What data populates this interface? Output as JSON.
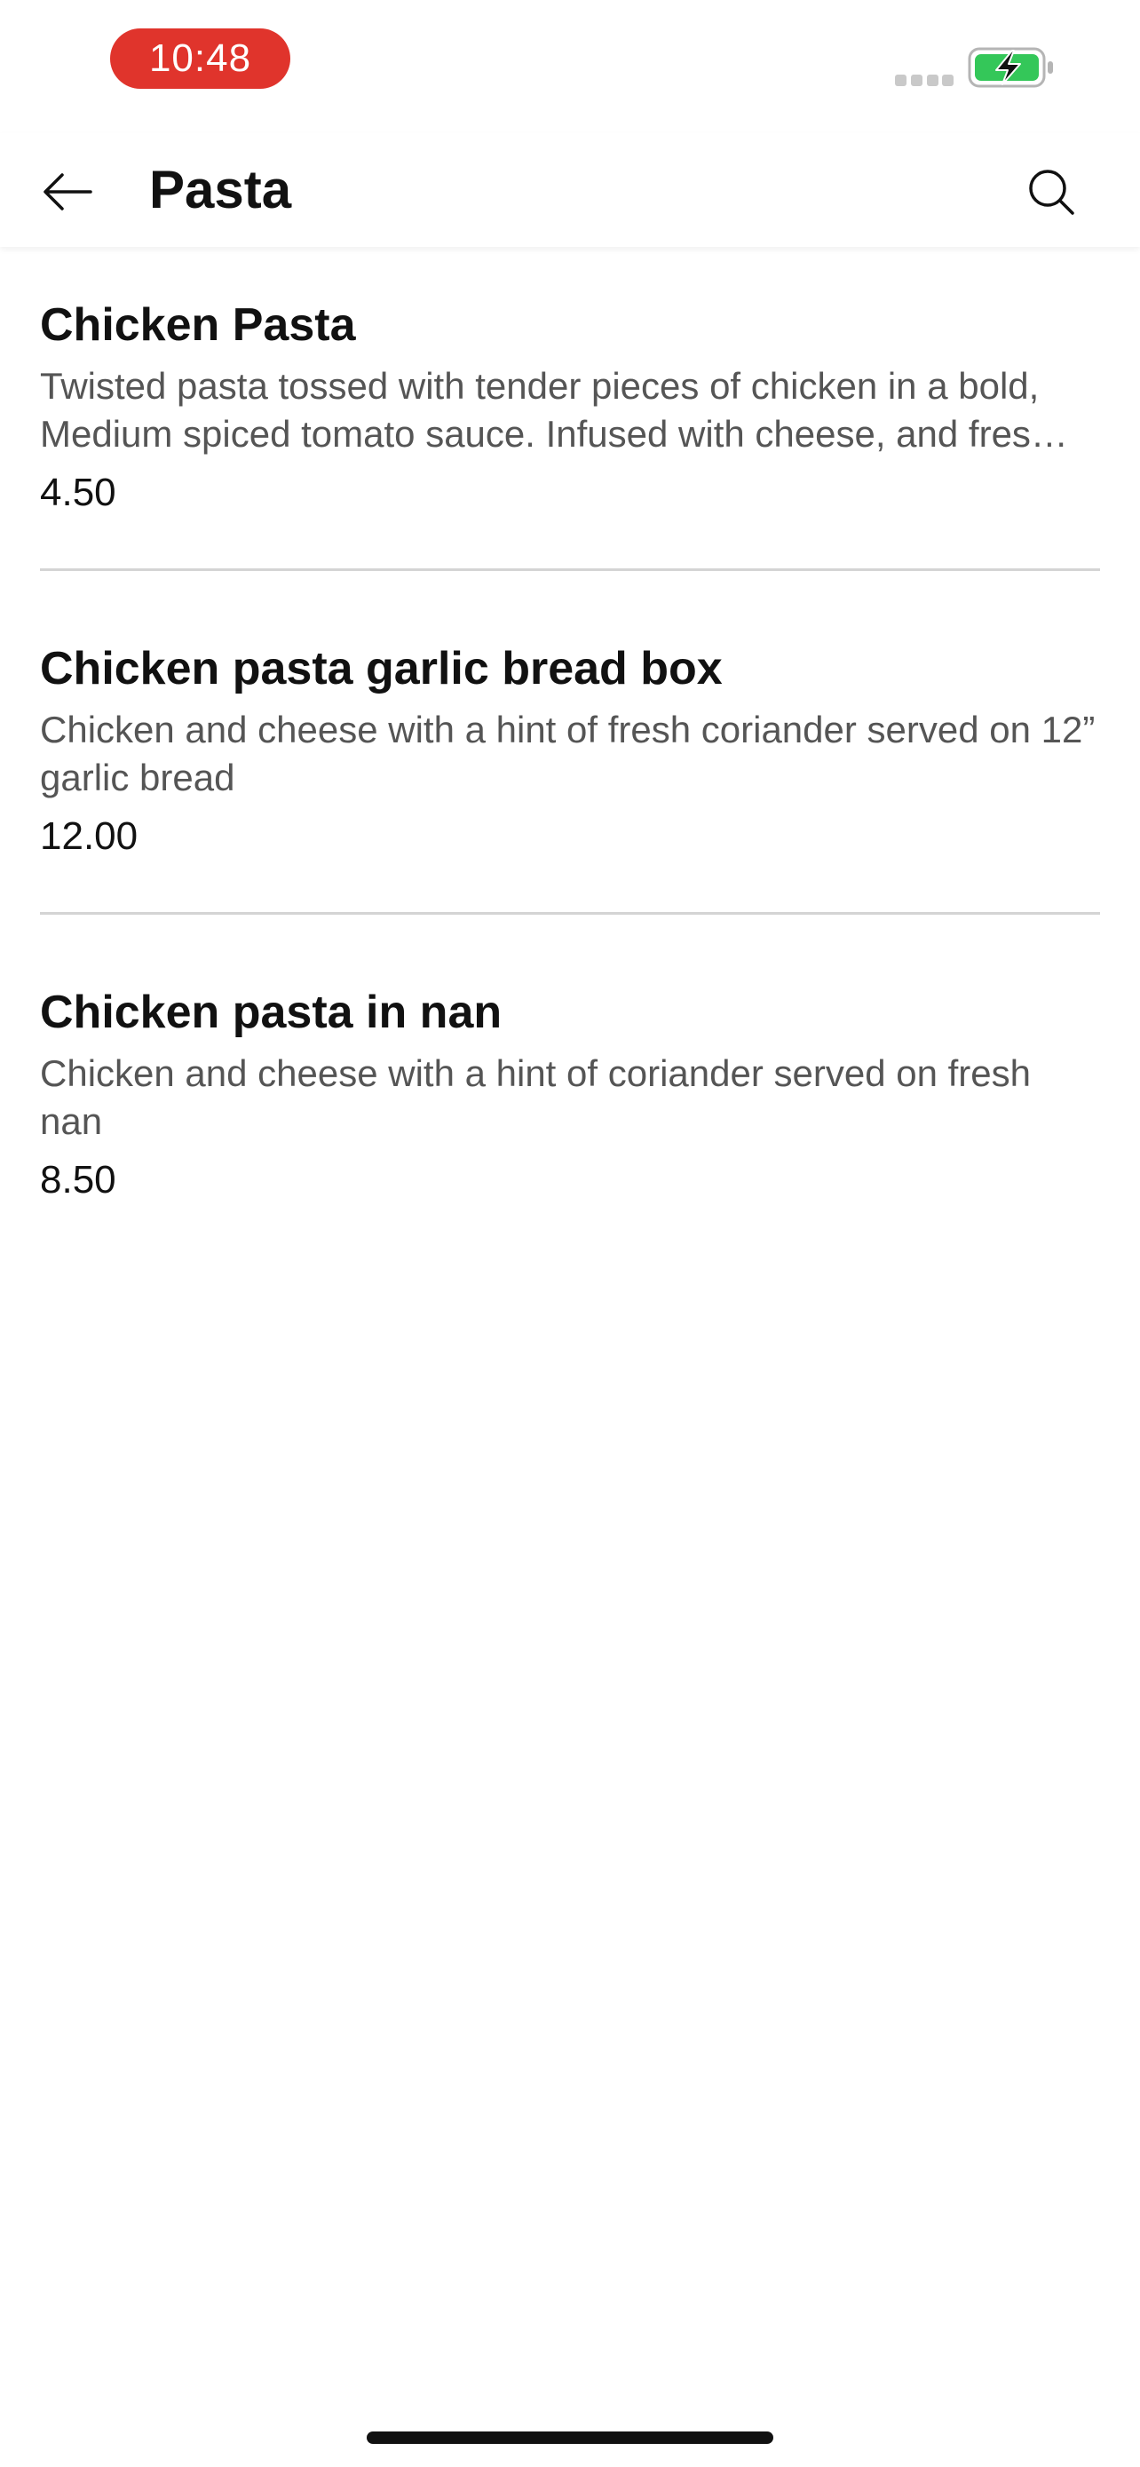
{
  "status_bar": {
    "time": "10:48",
    "time_pill_color": "#e0342c",
    "battery_color": "#34c759",
    "battery_state": "charging"
  },
  "header": {
    "title": "Pasta",
    "back_icon": "arrow-left-icon",
    "search_icon": "search-icon"
  },
  "items": [
    {
      "name": "Chicken Pasta",
      "description": "Twisted pasta tossed with tender pieces of chicken in a bold, Medium spiced tomato sauce. Infused with cheese, and fres…",
      "price": "4.50"
    },
    {
      "name": "Chicken pasta garlic bread box",
      "description": "Chicken and cheese with a hint of fresh coriander served on 12” garlic bread",
      "price": "12.00"
    },
    {
      "name": "Chicken pasta in nan",
      "description": "Chicken and cheese with a hint of coriander served on fresh nan",
      "price": "8.50"
    }
  ]
}
